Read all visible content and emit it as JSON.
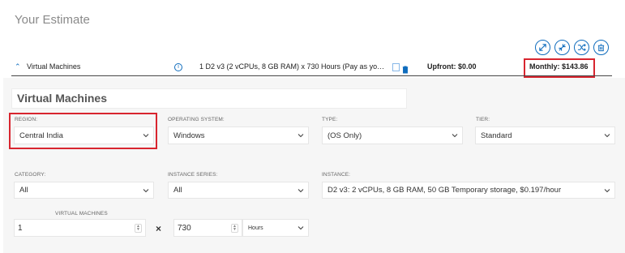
{
  "header": {
    "title": "Your Estimate"
  },
  "actions": [
    {
      "name": "expand",
      "label": "expand-icon"
    },
    {
      "name": "collapse",
      "label": "collapse-icon"
    },
    {
      "name": "shuffle",
      "label": "shuffle-icon"
    },
    {
      "name": "delete",
      "label": "delete-icon"
    }
  ],
  "summary": {
    "service": "Virtual Machines",
    "description": "1 D2 v3 (2 vCPUs, 8 GB RAM) x 730 Hours (Pay as yo…",
    "upfront": "Upfront: $0.00",
    "monthly": "Monthly: $143.86"
  },
  "section": {
    "heading": "Virtual Machines"
  },
  "fields": {
    "region": {
      "label": "REGION:",
      "value": "Central India"
    },
    "os": {
      "label": "OPERATING SYSTEM:",
      "value": "Windows"
    },
    "type": {
      "label": "TYPE:",
      "value": "(OS Only)"
    },
    "tier": {
      "label": "TIER:",
      "value": "Standard"
    },
    "category": {
      "label": "CATEGORY:",
      "value": "All"
    },
    "series": {
      "label": "INSTANCE SERIES:",
      "value": "All"
    },
    "instance": {
      "label": "INSTANCE:",
      "value": "D2 v3: 2 vCPUs, 8 GB RAM, 50 GB Temporary storage, $0.197/hour"
    },
    "vms": {
      "label": "VIRTUAL MACHINES",
      "value": "1"
    },
    "multiply": "×",
    "hours": {
      "value": "730",
      "unit": "Hours"
    }
  },
  "colors": {
    "accent": "#0f6cbd",
    "highlight": "#d8252f"
  }
}
